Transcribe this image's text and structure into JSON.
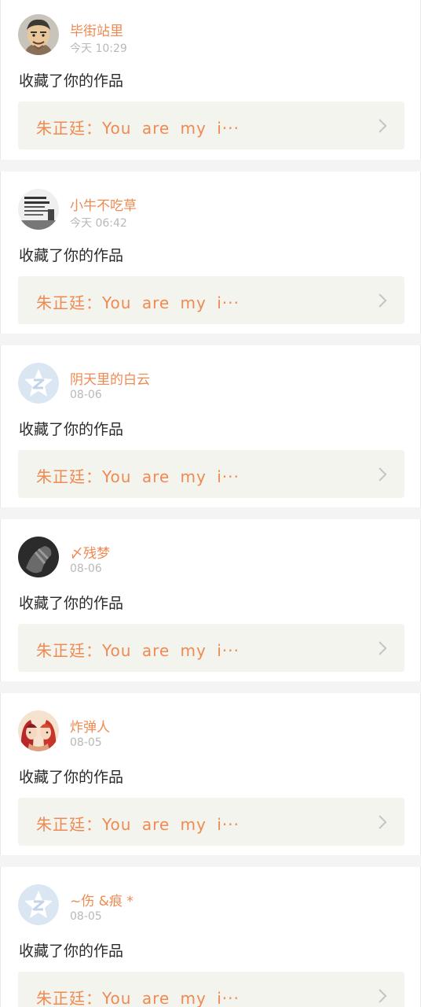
{
  "colors": {
    "accent": "#ee8a52",
    "timestamp": "#b8b8b8",
    "body_text": "#2a2a2a",
    "work_box_bg": "#f4f4ee",
    "separator": "#f4f4f4",
    "card_bg": "#ffffff"
  },
  "feed": {
    "items": [
      {
        "avatar_icon": "cartoon-man-avatar-icon",
        "username": "毕街站里",
        "time": "今天 10:29",
        "action": "收藏了你的作品",
        "work_title": "朱正廷：You are my i···",
        "chevron_icon": "chevron-right-icon"
      },
      {
        "avatar_icon": "text-poster-avatar-icon",
        "username": "小牛不吃草",
        "time": "今天 06:42",
        "action": "收藏了你的作品",
        "work_title": "朱正廷：You are my i···",
        "chevron_icon": "chevron-right-icon"
      },
      {
        "avatar_icon": "default-z-star-avatar-icon",
        "username": "阴天里的白云",
        "time": "08-06",
        "action": "收藏了你的作品",
        "work_title": "朱正廷：You are my i···",
        "chevron_icon": "chevron-right-icon"
      },
      {
        "avatar_icon": "dark-hand-avatar-icon",
        "username": "〆残梦",
        "time": "08-06",
        "action": "收藏了你的作品",
        "work_title": "朱正廷：You are my i···",
        "chevron_icon": "chevron-right-icon"
      },
      {
        "avatar_icon": "anime-girl-avatar-icon",
        "username": "炸弹人",
        "time": "08-05",
        "action": "收藏了你的作品",
        "work_title": "朱正廷：You are my i···",
        "chevron_icon": "chevron-right-icon"
      },
      {
        "avatar_icon": "default-z-star-avatar-icon",
        "username": "~伤 &痕 *",
        "time": "08-05",
        "action": "收藏了你的作品",
        "work_title": "朱正廷：You are my i···",
        "chevron_icon": "chevron-right-icon"
      }
    ]
  }
}
